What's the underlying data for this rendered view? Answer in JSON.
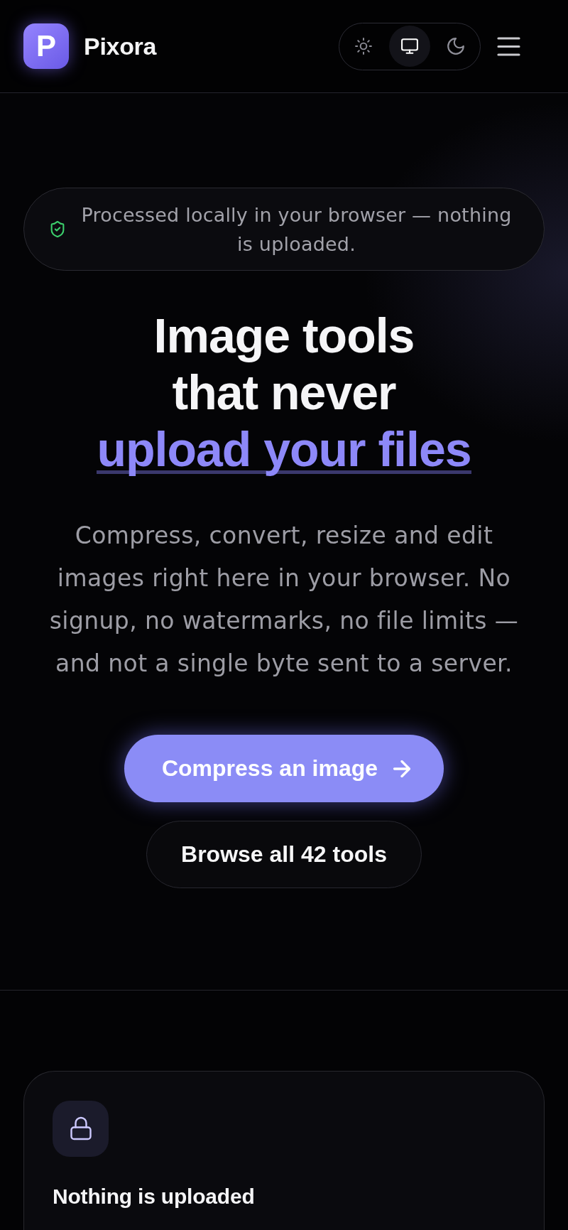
{
  "header": {
    "logo_letter": "P",
    "brand": "Pixora",
    "theme_options": [
      {
        "kind": "light",
        "selected": false
      },
      {
        "kind": "system",
        "selected": true
      },
      {
        "kind": "dark",
        "selected": false
      }
    ]
  },
  "hero": {
    "notice": "Processed locally in your browser — nothing is uploaded.",
    "heading": "Image tools that never",
    "heading_highlight": "upload your files",
    "description": "Compress, convert, resize and edit images right here in your browser. No signup, no watermarks, no file limits — and not a single byte sent to a server.",
    "primary_button": "Compress an image",
    "secondary_button": "Browse all 42 tools"
  },
  "features": [
    {
      "kind": "lock",
      "title": "Nothing is uploaded"
    }
  ]
}
